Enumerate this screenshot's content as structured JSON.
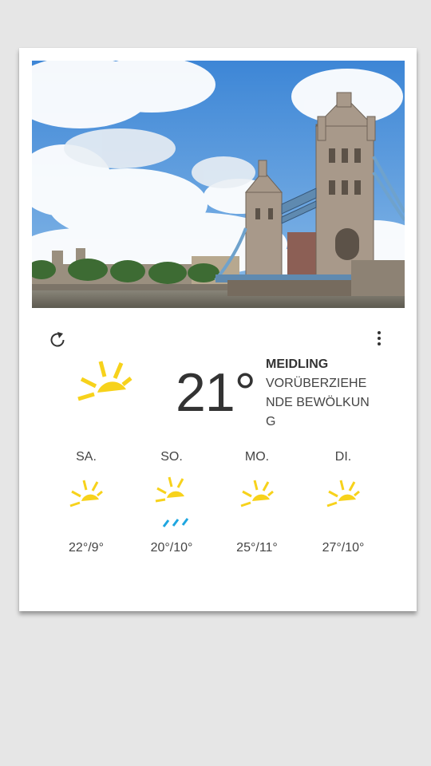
{
  "current": {
    "location": "MEIDLING",
    "condition": "VORÜBERZIEHENDE BEWÖLKUNG",
    "temperature": "21°",
    "icon": "partly-sunny-icon"
  },
  "toolbar": {
    "refresh_icon": "refresh-icon",
    "menu_icon": "overflow-menu-icon"
  },
  "photo": {
    "subject": "tower-bridge-london"
  },
  "forecast": [
    {
      "day": "SA.",
      "temps": "22°/9°",
      "icon": "partly-sunny-icon"
    },
    {
      "day": "SO.",
      "temps": "20°/10°",
      "icon": "sun-rain-icon"
    },
    {
      "day": "MO.",
      "temps": "25°/11°",
      "icon": "partly-sunny-icon"
    },
    {
      "day": "DI.",
      "temps": "27°/10°",
      "icon": "partly-sunny-icon"
    }
  ],
  "colors": {
    "sun": "#f7d21b",
    "rain": "#1ea6e0",
    "text": "#333333",
    "card": "#ffffff",
    "background": "#e6e6e6"
  }
}
